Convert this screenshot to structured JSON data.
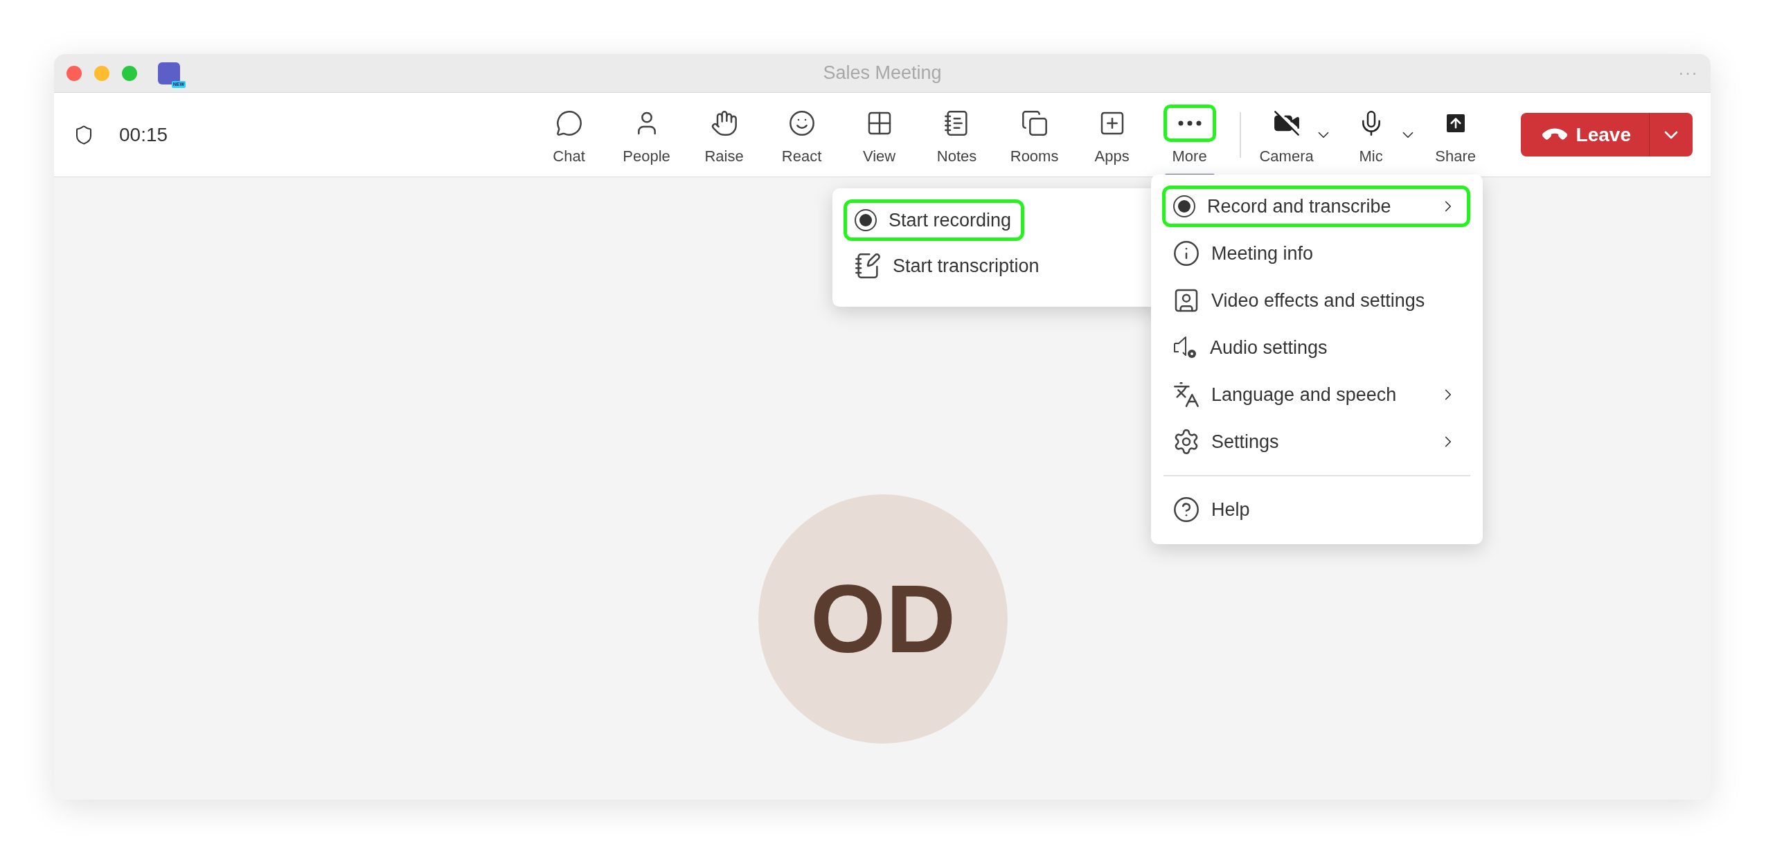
{
  "window": {
    "title": "Sales Meeting",
    "app_badge": "NEW",
    "overflow": "···"
  },
  "toolbar": {
    "timer": "00:15",
    "buttons": [
      {
        "label": "Chat",
        "selected": false,
        "highlighted": false
      },
      {
        "label": "People",
        "selected": false,
        "highlighted": false
      },
      {
        "label": "Raise",
        "selected": false,
        "highlighted": false
      },
      {
        "label": "React",
        "selected": false,
        "highlighted": false
      },
      {
        "label": "View",
        "selected": false,
        "highlighted": false
      },
      {
        "label": "Notes",
        "selected": false,
        "highlighted": false
      },
      {
        "label": "Rooms",
        "selected": false,
        "highlighted": false
      },
      {
        "label": "Apps",
        "selected": false,
        "highlighted": false
      },
      {
        "label": "More",
        "selected": true,
        "highlighted": true
      }
    ],
    "devices": [
      {
        "label": "Camera",
        "on": false,
        "dropdown": true
      },
      {
        "label": "Mic",
        "on": true,
        "dropdown": true
      },
      {
        "label": "Share",
        "on": true,
        "dropdown": false
      }
    ],
    "leave": {
      "label": "Leave"
    }
  },
  "more_menu": {
    "sections": [
      [
        {
          "label": "Record and transcribe",
          "submenu": true,
          "highlighted": true
        },
        {
          "label": "Meeting info",
          "submenu": false,
          "highlighted": false
        },
        {
          "label": "Video effects and settings",
          "submenu": false,
          "highlighted": false
        },
        {
          "label": "Audio settings",
          "submenu": false,
          "highlighted": false
        },
        {
          "label": "Language and speech",
          "submenu": true,
          "highlighted": false
        },
        {
          "label": "Settings",
          "submenu": true,
          "highlighted": false
        }
      ],
      [
        {
          "label": "Help",
          "submenu": false,
          "highlighted": false
        }
      ]
    ]
  },
  "record_submenu": {
    "items": [
      {
        "label": "Start recording",
        "highlighted": true
      },
      {
        "label": "Start transcription",
        "highlighted": false
      }
    ]
  },
  "participant": {
    "initials": "OD"
  }
}
